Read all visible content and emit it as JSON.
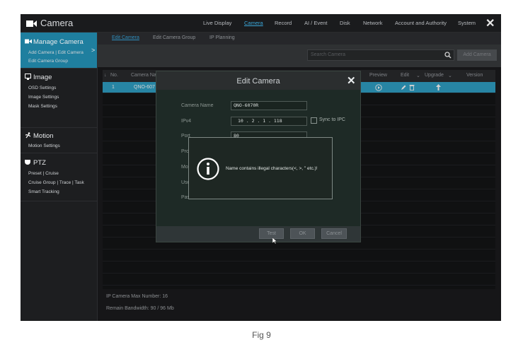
{
  "app": {
    "title": "Camera",
    "close_label": "✕"
  },
  "nav": {
    "items": [
      {
        "label": "Live Display"
      },
      {
        "label": "Camera"
      },
      {
        "label": "Record"
      },
      {
        "label": "AI / Event"
      },
      {
        "label": "Disk"
      },
      {
        "label": "Network"
      },
      {
        "label": "Account and Authority"
      },
      {
        "label": "System"
      }
    ],
    "active": "Camera"
  },
  "sidebar": {
    "manage": {
      "title": "Manage Camera",
      "sub1": "Add Camera | Edit Camera",
      "sub2": "Edit Camera Group",
      "chevron": ">"
    },
    "image": {
      "title": "Image",
      "subs": [
        "OSD Settings",
        "Image Settings",
        "Mask Settings"
      ]
    },
    "motion": {
      "title": "Motion",
      "subs": [
        "Motion Settings"
      ]
    },
    "ptz": {
      "title": "PTZ",
      "subs": [
        "Preset | Cruise",
        "Cruise Group | Trace | Task",
        "Smart Tracking"
      ]
    }
  },
  "tabs": [
    {
      "label": "Edit Camera"
    },
    {
      "label": "Edit Camera Group"
    },
    {
      "label": "IP Planning"
    }
  ],
  "toolbar": {
    "search_placeholder": "Search Camera",
    "add_camera": "Add Camera"
  },
  "table": {
    "headers": {
      "no": "No.",
      "camera_name": "Camera Na",
      "preview": "Preview",
      "edit": "Edit",
      "upgrade": "Upgrade",
      "version": "Version"
    },
    "sort_arrow": "↓",
    "rows": [
      {
        "no": "1",
        "camera_name": "QNO-607"
      }
    ]
  },
  "footer": {
    "max_number": "IP Camera Max Number: 16",
    "bandwidth": "Remain Bandwidth: 90 / 96 Mb"
  },
  "dialog": {
    "title": "Edit Camera",
    "fields": [
      {
        "label": "Camera Name",
        "value": "QNO-6070R"
      },
      {
        "label": "IPv4",
        "value": "10  .  2  .  1  .  118"
      },
      {
        "label": "Port",
        "value": "80"
      },
      {
        "label": "Pro"
      },
      {
        "label": "Mo"
      },
      {
        "label": "Use"
      },
      {
        "label": "Pas"
      }
    ],
    "sync_label": "Sync to IPC",
    "buttons": {
      "test": "Test",
      "ok": "OK",
      "cancel": "Cancel"
    }
  },
  "alert": {
    "message": "Name contains illegal characters(<,  >,  \" etc.)!"
  },
  "caption": "Fig 9",
  "colors": {
    "accent": "#30a3c8",
    "active_nav": "#3aa6d8",
    "sidebar_active": "#1f7f9f"
  }
}
